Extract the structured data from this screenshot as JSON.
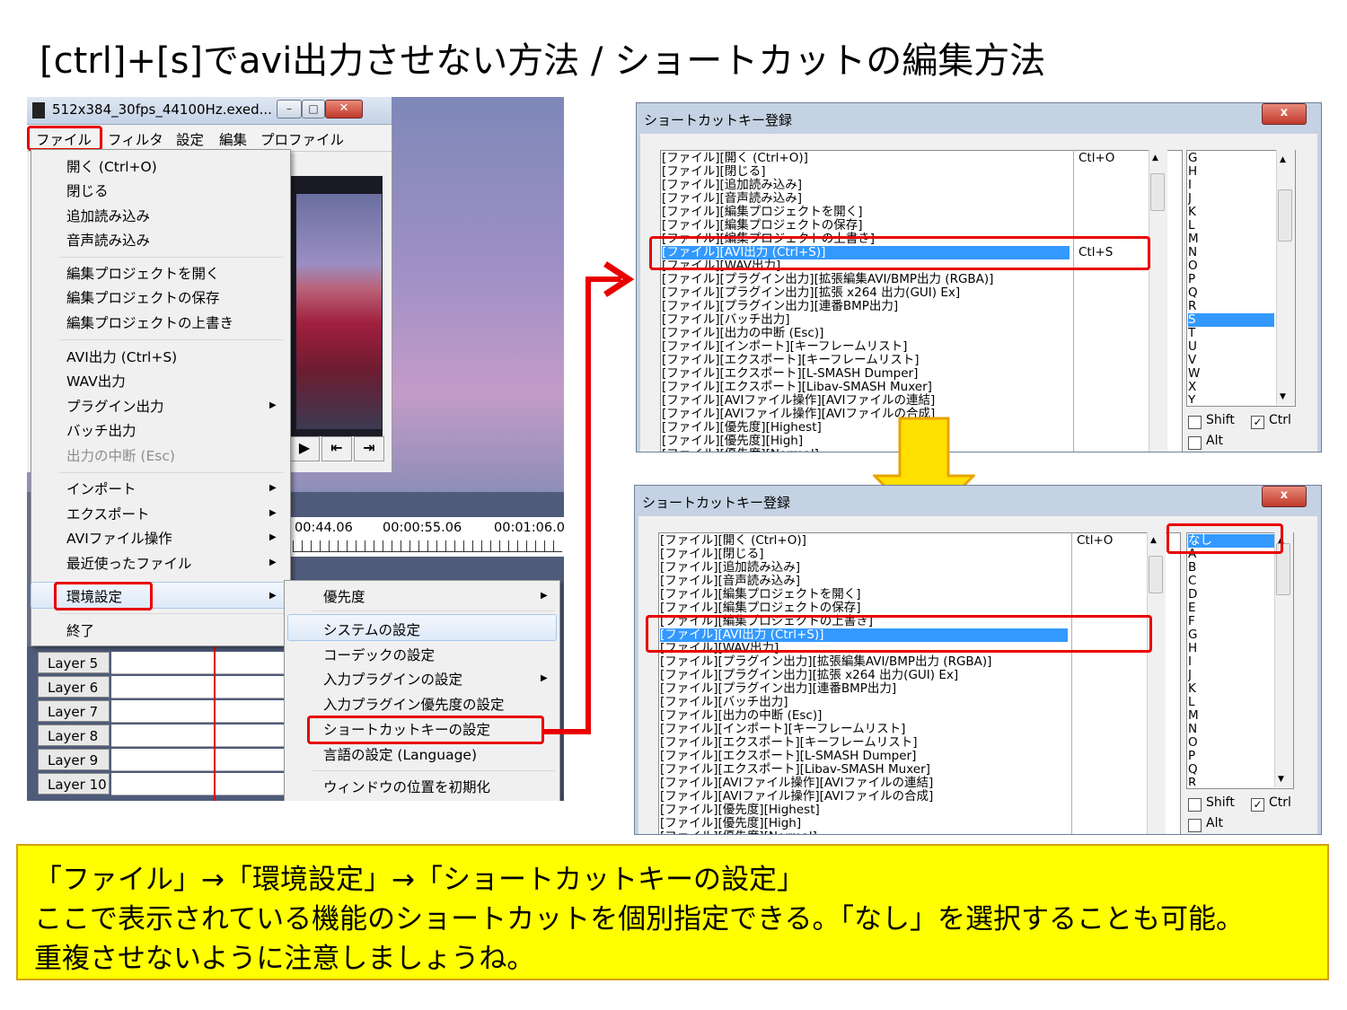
{
  "slide": {
    "title": "[ctrl]+[s]でavi出力させない方法 / ショートカットの編集方法"
  },
  "main_window": {
    "title": "512x384_30fps_44100Hz.exed...",
    "menubar": [
      "ファイル",
      "フィルタ",
      "設定",
      "編集",
      "プロファイル"
    ],
    "file_menu": {
      "group1": [
        "開く (Ctrl+O)",
        "閉じる",
        "追加読み込み",
        "音声読み込み"
      ],
      "group2": [
        "編集プロジェクトを開く",
        "編集プロジェクトの保存",
        "編集プロジェクトの上書き"
      ],
      "group3": [
        "AVI出力 (Ctrl+S)",
        "WAV出力",
        "プラグイン出力",
        "バッチ出力",
        "出力の中断 (Esc)"
      ],
      "group4": [
        "インポート",
        "エクスポート",
        "AVIファイル操作",
        "最近使ったファイル"
      ],
      "env": "環境設定",
      "exit": "終了"
    },
    "env_submenu": [
      "優先度",
      "システムの設定",
      "コーデックの設定",
      "入力プラグインの設定",
      "入力プラグイン優先度の設定",
      "ショートカットキーの設定",
      "言語の設定 (Language)",
      "ウィンドウの位置を初期化"
    ],
    "timeline_times": [
      "00:44.06",
      "00:00:55.06",
      "00:01:06.0"
    ],
    "layers": [
      "Layer  5",
      "Layer  6",
      "Layer  7",
      "Layer  8",
      "Layer  9",
      "Layer 10"
    ]
  },
  "dialog_before": {
    "title": "ショートカットキー登録",
    "close": "x",
    "commands": [
      "[ファイル][開く (Ctrl+O)]",
      "[ファイル][閉じる]",
      "[ファイル][追加読み込み]",
      "[ファイル][音声読み込み]",
      "[ファイル][編集プロジェクトを開く]",
      "[ファイル][編集プロジェクトの保存]",
      "[ファイル][編集プロジェクトの上書き]",
      "[ファイル][AVI出力 (Ctrl+S)]",
      "[ファイル][WAV出力]",
      "[ファイル][プラグイン出力][拡張編集AVI/BMP出力 (RGBA)]",
      "[ファイル][プラグイン出力][拡張 x264 出力(GUI) Ex]",
      "[ファイル][プラグイン出力][連番BMP出力]",
      "[ファイル][バッチ出力]",
      "[ファイル][出力の中断 (Esc)]",
      "[ファイル][インポート][キーフレームリスト]",
      "[ファイル][エクスポート][キーフレームリスト]",
      "[ファイル][エクスポート][L-SMASH Dumper]",
      "[ファイル][エクスポート][Libav-SMASH Muxer]",
      "[ファイル][AVIファイル操作][AVIファイルの連結]",
      "[ファイル][AVIファイル操作][AVIファイルの合成]",
      "[ファイル][優先度][Highest]",
      "[ファイル][優先度][High]",
      "[ファイル][優先度][Normal]"
    ],
    "shortcut_open": "Ctl+O",
    "shortcut_avi": "Ctl+S",
    "keys": [
      "G",
      "H",
      "I",
      "J",
      "K",
      "L",
      "M",
      "N",
      "O",
      "P",
      "Q",
      "R",
      "S",
      "T",
      "U",
      "V",
      "W",
      "X",
      "Y"
    ],
    "selected_key": "S",
    "shift": "Shift",
    "ctrl": "Ctrl",
    "alt": "Alt"
  },
  "dialog_after": {
    "title": "ショートカットキー登録",
    "close": "x",
    "shortcut_open": "Ctl+O",
    "keys": [
      "なし",
      "A",
      "B",
      "C",
      "D",
      "E",
      "F",
      "G",
      "H",
      "I",
      "J",
      "K",
      "L",
      "M",
      "N",
      "O",
      "P",
      "Q",
      "R"
    ],
    "selected_key": "なし",
    "shift": "Shift",
    "ctrl": "Ctrl",
    "alt": "Alt"
  },
  "note": {
    "line1": "「ファイル」→「環境設定」→「ショートカットキーの設定」",
    "line2": "ここで表示されている機能のショートカットを個別指定できる。「なし」を選択することも可能。",
    "line3": "重複させないように注意しましょうね。"
  },
  "colors": {
    "highlight_red": "#e80000",
    "arrow_yellow": "#ffe000",
    "note_bg": "#ffff00",
    "selection_blue": "#3399ff"
  }
}
